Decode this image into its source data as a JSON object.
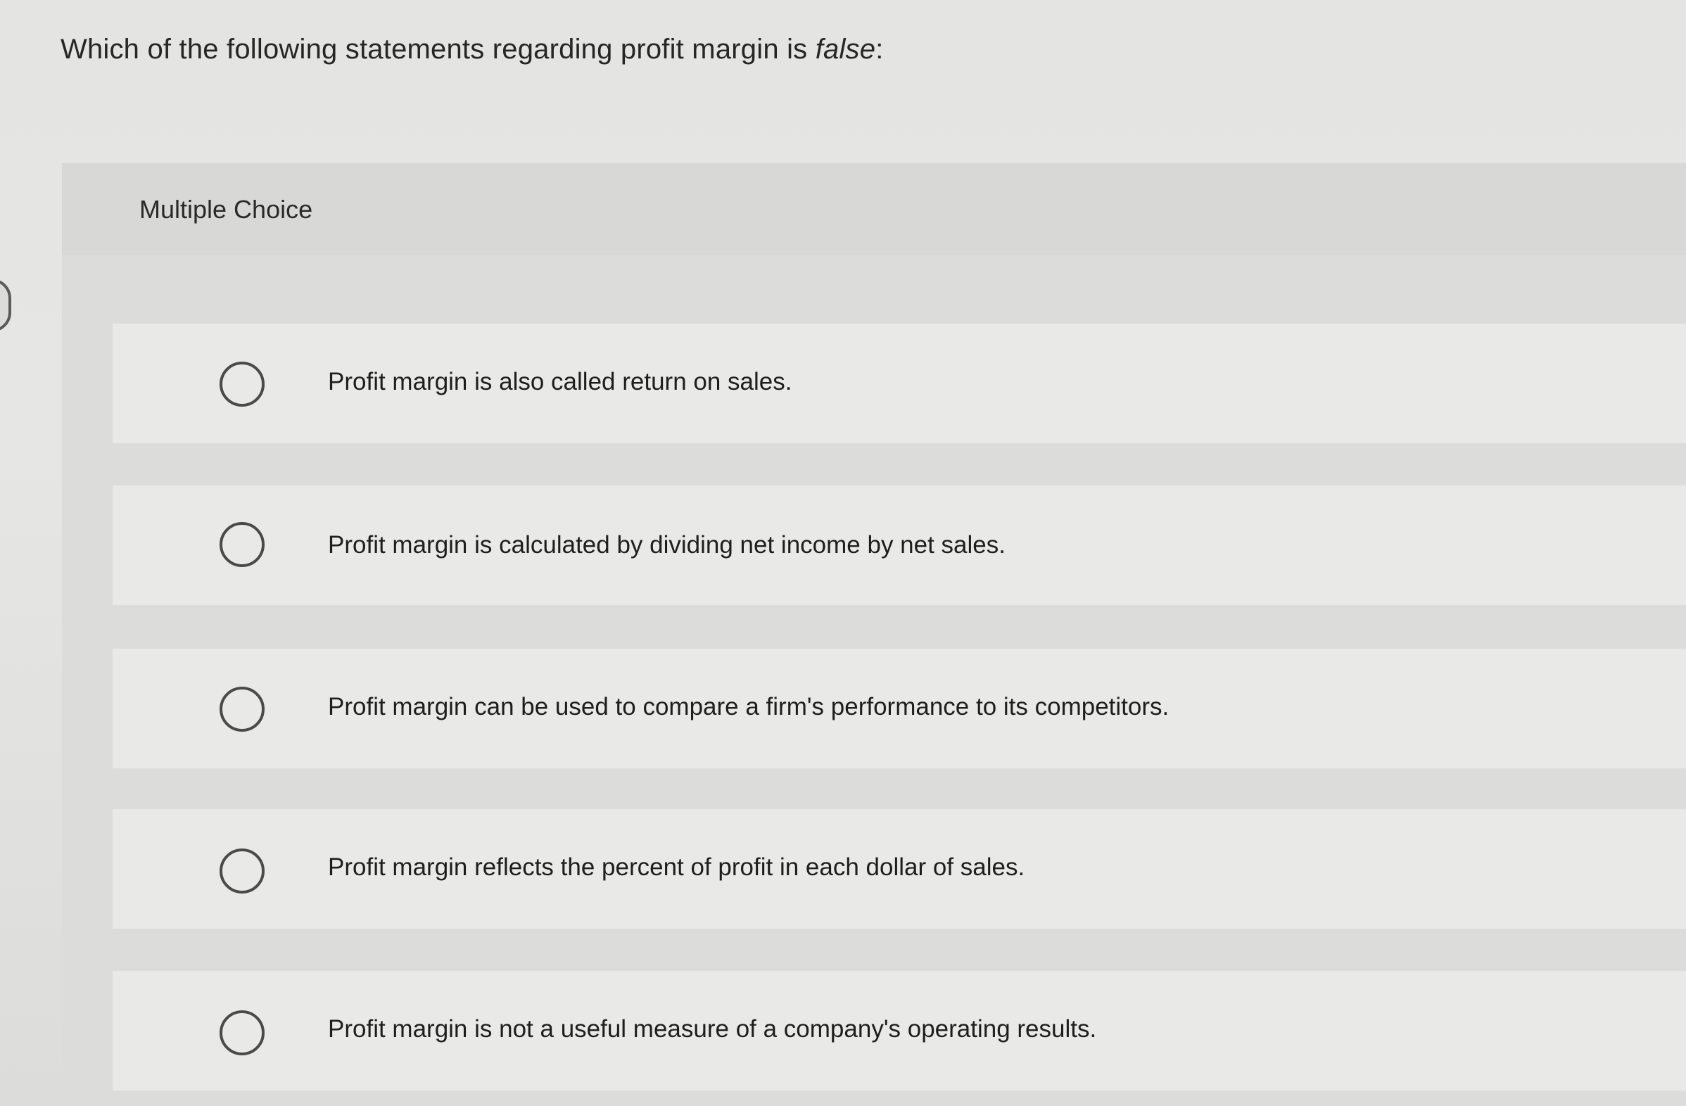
{
  "question": {
    "text_before": "Which of the following statements regarding profit margin is ",
    "emphasis": "false",
    "text_after": ":"
  },
  "panel": {
    "label": "Multiple Choice"
  },
  "options": [
    {
      "label": "Profit margin is also called return on sales.",
      "selected": false
    },
    {
      "label": "Profit margin is calculated by dividing net income by net sales.",
      "selected": false
    },
    {
      "label": "Profit margin can be used to compare a firm's performance to its competitors.",
      "selected": false
    },
    {
      "label": "Profit margin reflects the percent of profit in each dollar of sales.",
      "selected": false
    },
    {
      "label": "Profit margin is not a useful measure of a company's operating results.",
      "selected": false
    }
  ]
}
